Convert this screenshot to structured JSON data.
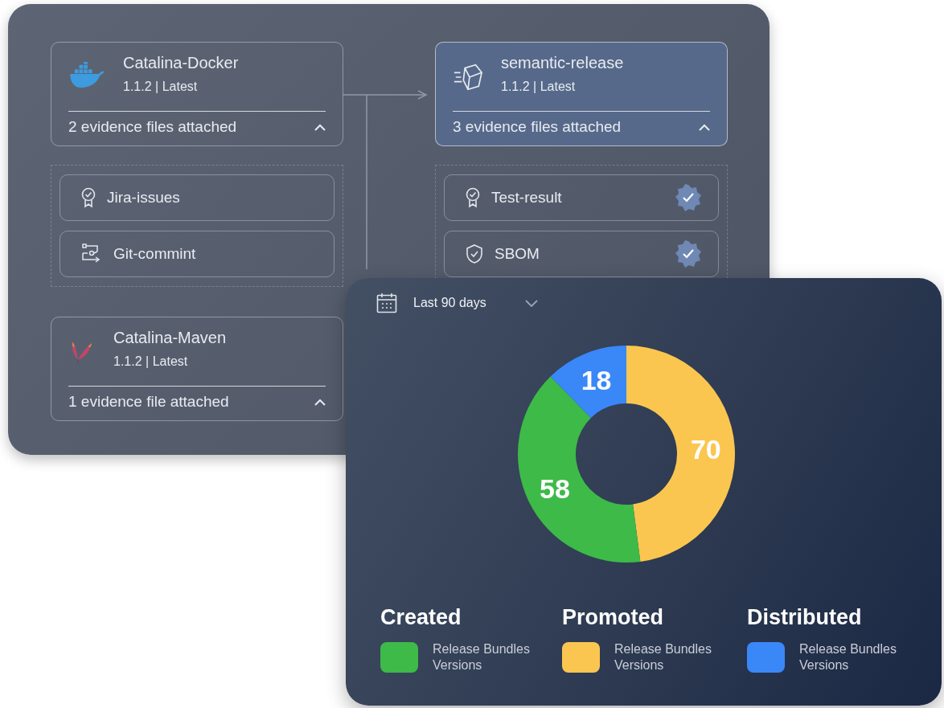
{
  "columns": [
    {
      "nodes": [
        {
          "kind": "docker",
          "title": "Catalina-Docker",
          "version": "1.1.2 | Latest",
          "evidence": "2 evidence files attached",
          "selected": false,
          "expanded": true,
          "items": [
            {
              "kind": "award",
              "label": "Jira-issues",
              "verified": false
            },
            {
              "kind": "commit",
              "label": "Git-commint",
              "verified": false
            }
          ]
        },
        {
          "kind": "maven",
          "title": "Catalina-Maven",
          "version": "1.1.2 | Latest",
          "evidence": "1 evidence file attached",
          "selected": false,
          "expanded": true
        }
      ]
    },
    {
      "nodes": [
        {
          "kind": "package",
          "title": "semantic-release",
          "version": "1.1.2 | Latest",
          "evidence": "3 evidence files attached",
          "selected": true,
          "expanded": true,
          "items": [
            {
              "kind": "award",
              "label": "Test-result",
              "verified": true
            },
            {
              "kind": "shield",
              "label": "SBOM",
              "verified": true
            }
          ]
        }
      ]
    }
  ],
  "dashboard": {
    "range": "Last 90 days",
    "chart_data": {
      "type": "donut",
      "categories": [
        "Created",
        "Promoted",
        "Distributed"
      ],
      "values": [
        58,
        70,
        18
      ],
      "data_labels": true
    },
    "legend": [
      {
        "label": "Release Bundles Versions",
        "color": "#3dba48"
      },
      {
        "label": "Release Bundles Versions",
        "color": "#fbc650"
      },
      {
        "label": "Release Bundles Versions",
        "color": "#3a87f8"
      }
    ]
  }
}
